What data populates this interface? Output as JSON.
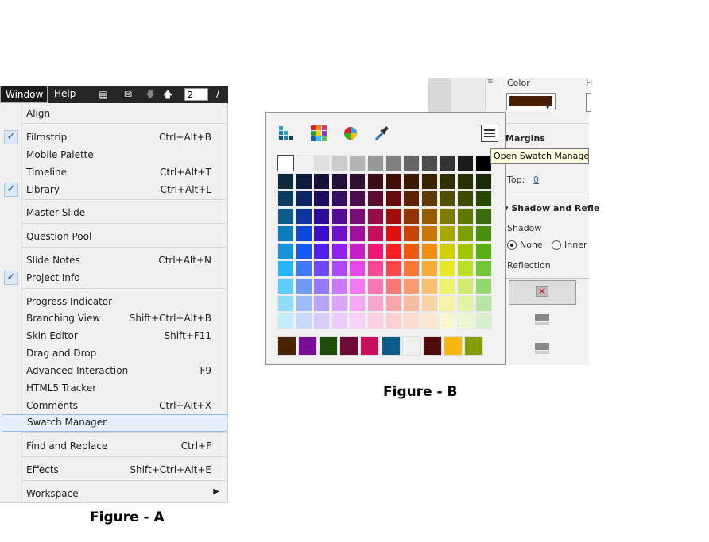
{
  "menubar": {
    "items": [
      "Window",
      "Help"
    ],
    "page_number": "2",
    "page_separator": "/"
  },
  "window_menu": {
    "items": [
      {
        "label": "Align",
        "shortcut": "",
        "checked": false
      },
      {
        "label": "Filmstrip",
        "shortcut": "Ctrl+Alt+B",
        "checked": true
      },
      {
        "label": "Mobile Palette",
        "shortcut": "",
        "checked": false
      },
      {
        "label": "Timeline",
        "shortcut": "Ctrl+Alt+T",
        "checked": false
      },
      {
        "label": "Library",
        "shortcut": "Ctrl+Alt+L",
        "checked": true
      },
      {
        "label": "Master Slide",
        "shortcut": "",
        "checked": false
      },
      {
        "label": "Question Pool",
        "shortcut": "",
        "checked": false
      },
      {
        "label": "Slide Notes",
        "shortcut": "Ctrl+Alt+N",
        "checked": false
      },
      {
        "label": "Project Info",
        "shortcut": "",
        "checked": true
      },
      {
        "label": "Progress Indicator",
        "shortcut": "",
        "checked": false
      },
      {
        "label": "Branching View",
        "shortcut": "Shift+Ctrl+Alt+B",
        "checked": false
      },
      {
        "label": "Skin Editor",
        "shortcut": "Shift+F11",
        "checked": false
      },
      {
        "label": "Drag and Drop",
        "shortcut": "",
        "checked": false
      },
      {
        "label": "Advanced Interaction",
        "shortcut": "F9",
        "checked": false
      },
      {
        "label": "HTML5 Tracker",
        "shortcut": "",
        "checked": false
      },
      {
        "label": "Comments",
        "shortcut": "Ctrl+Alt+X",
        "checked": false
      },
      {
        "label": "Swatch Manager",
        "shortcut": "",
        "checked": false,
        "highlighted": true
      },
      {
        "label": "Find and Replace",
        "shortcut": "Ctrl+F",
        "checked": false
      },
      {
        "label": "Effects",
        "shortcut": "Shift+Ctrl+Alt+E",
        "checked": false
      },
      {
        "label": "Workspace",
        "shortcut": "",
        "checked": false,
        "submenu": true
      }
    ],
    "caption": "Figure - A"
  },
  "swatch_panel": {
    "tooltip": "Open Swatch Manager",
    "grid_rows": [
      [
        "#ffffff",
        "#f0f0f0",
        "#e0e0e0",
        "#cccccc",
        "#b4b4b4",
        "#999999",
        "#808080",
        "#666666",
        "#4d4d4d",
        "#333333",
        "#1a1a1a",
        "#000000"
      ],
      [
        "#0c2a3e",
        "#0c1a40",
        "#141038",
        "#201038",
        "#301030",
        "#3c0c18",
        "#401008",
        "#3c1800",
        "#382400",
        "#303000",
        "#283000",
        "#182a08"
      ],
      [
        "#0c3c5e",
        "#0a2464",
        "#1c0c5c",
        "#360c5c",
        "#4c0c4c",
        "#5c0c2c",
        "#640c0c",
        "#5c2404",
        "#5c3c04",
        "#505000",
        "#3c4c00",
        "#284808"
      ],
      [
        "#0c5c8c",
        "#0c34a0",
        "#2c0c94",
        "#540c94",
        "#780c78",
        "#940c44",
        "#a00c0c",
        "#943404",
        "#945c04",
        "#7c7c00",
        "#5c7800",
        "#386c0c"
      ],
      [
        "#0c7cbc",
        "#0c48dc",
        "#3c10c8",
        "#7010c8",
        "#a010a0",
        "#c8105c",
        "#dc1010",
        "#c84408",
        "#c87808",
        "#a8a800",
        "#7ca000",
        "#48900c"
      ],
      [
        "#1494dc",
        "#1458f8",
        "#5020f0",
        "#9020f0",
        "#c820c8",
        "#f01874",
        "#f82020",
        "#f05810",
        "#f09010",
        "#d0d000",
        "#a0c800",
        "#58b014"
      ],
      [
        "#28b4f8",
        "#3c78f8",
        "#7048f8",
        "#b048f8",
        "#e848e8",
        "#f84898",
        "#f84848",
        "#f87838",
        "#f8ac38",
        "#e8e828",
        "#bce028",
        "#70c838"
      ],
      [
        "#5cccf8",
        "#6c9cf8",
        "#9478f8",
        "#c878f8",
        "#f078f0",
        "#f878b4",
        "#f87878",
        "#f89c70",
        "#f8c070",
        "#f0f070",
        "#d0ec70",
        "#94d870"
      ],
      [
        "#90dcf8",
        "#9cbcf8",
        "#b8a4f8",
        "#dca4f8",
        "#f4a8f4",
        "#f8a8cc",
        "#f8a8a8",
        "#f8bca4",
        "#f8d4a4",
        "#f4f4a4",
        "#e0f4a4",
        "#b8e4a4"
      ],
      [
        "#c4ecfc",
        "#c8d8fc",
        "#d8ccfc",
        "#ecccfc",
        "#f8d0f8",
        "#fcd0e4",
        "#fcd0d0",
        "#fcdcd0",
        "#fce8d0",
        "#f8f8d0",
        "#ecf8d0",
        "#d8f0d0"
      ]
    ],
    "recent_swatches": [
      "#4a2400",
      "#780c94",
      "#1e4c0a",
      "#6c0c34",
      "#c8105c",
      "#0c5c8c",
      "#f0f0f0",
      "#500c08",
      "#f8b810",
      "#849c00"
    ],
    "caption": "Figure - B"
  },
  "properties": {
    "color_label": "Color",
    "color_value": "#4a1e00",
    "margins_heading": "Margins",
    "top_label": "Top:",
    "top_value": "0",
    "shadow_heading": "▾ Shadow and Refle",
    "shadow_label": "Shadow",
    "none_label": "None",
    "inner_label": "Inner",
    "reflection_label": "Reflection",
    "h_label": "H"
  }
}
